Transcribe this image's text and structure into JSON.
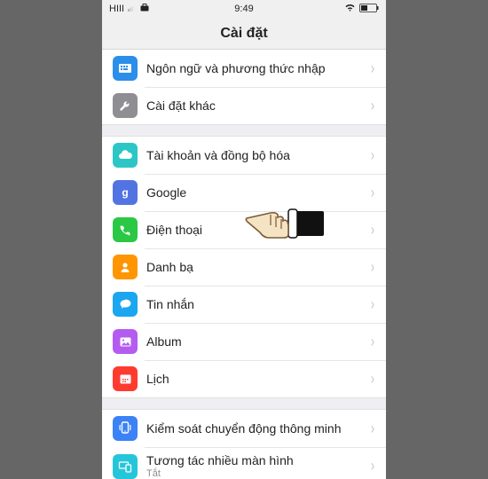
{
  "statusbar": {
    "carrier": "HIII",
    "time": "9:49"
  },
  "title": "Cài đặt",
  "group1": {
    "language": "Ngôn ngữ và phương thức nhập",
    "more": "Cài đặt khác"
  },
  "group2": {
    "accounts": "Tài khoản và đồng bộ hóa",
    "google": "Google",
    "phone": "Điện thoại",
    "contacts": "Danh bạ",
    "messages": "Tin nhắn",
    "album": "Album",
    "calendar": "Lịch"
  },
  "group3": {
    "motion": "Kiểm soát chuyển động thông minh",
    "multiscreen": "Tương tác nhiều màn hình",
    "multiscreen_sub": "Tắt"
  },
  "colors": {
    "blue": "#2b8eea",
    "gray": "#8e8e93",
    "teal": "#2dc6c6",
    "indigo": "#5274e3",
    "green": "#2ac845",
    "orange": "#ff9500",
    "cyan": "#1aa6f0",
    "cyan2": "#20a0ff",
    "purple": "#b45cf0",
    "red": "#ff3b30",
    "blue2": "#3b82f6",
    "teal2": "#26c6da"
  }
}
